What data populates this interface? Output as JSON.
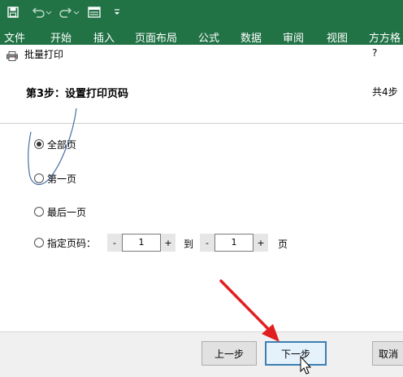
{
  "ribbon": {
    "tabs": [
      "文件",
      "开始",
      "插入",
      "页面布局",
      "公式",
      "数据",
      "审阅",
      "视图",
      "方方格"
    ]
  },
  "qat": {
    "icons": [
      "save-icon",
      "undo-icon",
      "redo-icon",
      "form-icon",
      "customize-icon"
    ]
  },
  "dialog": {
    "title": "批量打印",
    "help": "?",
    "step_title": "第3步：设置打印页码",
    "step_count": "共4步",
    "options": [
      {
        "label": "全部页",
        "checked": true
      },
      {
        "label": "第一页",
        "checked": false
      },
      {
        "label": "最后一页",
        "checked": false
      },
      {
        "label": "指定页码：",
        "checked": false
      }
    ],
    "range": {
      "from_value": "1",
      "to_label": "到",
      "to_value": "1",
      "unit_label": "页",
      "minus": "-",
      "plus": "+"
    },
    "buttons": {
      "prev": "上一步",
      "next": "下一步",
      "cancel": "取消"
    }
  },
  "colors": {
    "excel_green": "#217346",
    "annotation_arrow": "#e02020",
    "focus_border": "#3c7fb1"
  }
}
